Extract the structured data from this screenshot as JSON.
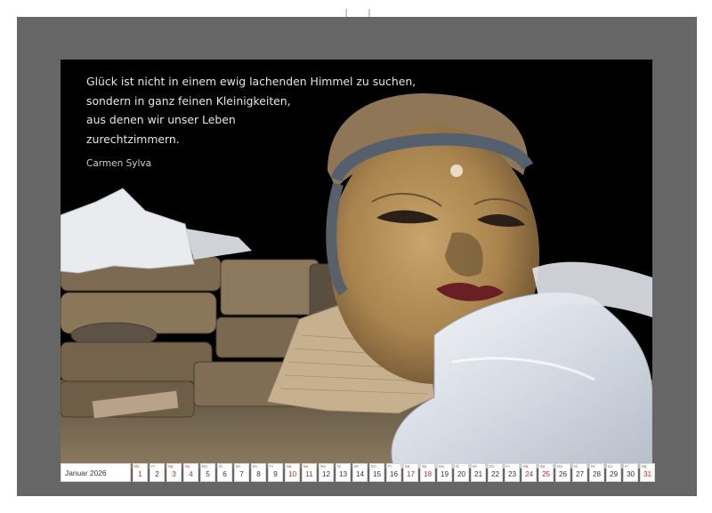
{
  "quote": {
    "lines": [
      "Glück ist nicht in einem ewig lachenden Himmel zu suchen,",
      "sondern in ganz feinen Kleinigkeiten,",
      "aus denen wir unser Leben",
      "zurechtzimmern."
    ],
    "author": "Carmen Sylva"
  },
  "calendar": {
    "month_label": "Januar 2026",
    "days": [
      {
        "wd": "Do",
        "num": "1",
        "holiday": true
      },
      {
        "wd": "Fr",
        "num": "2",
        "holiday": false
      },
      {
        "wd": "Sa",
        "num": "3",
        "holiday": true
      },
      {
        "wd": "So",
        "num": "4",
        "holiday": true
      },
      {
        "wd": "Mo",
        "num": "5",
        "holiday": false
      },
      {
        "wd": "Di",
        "num": "6",
        "holiday": false
      },
      {
        "wd": "Mi",
        "num": "7",
        "holiday": false
      },
      {
        "wd": "Do",
        "num": "8",
        "holiday": false
      },
      {
        "wd": "Fr",
        "num": "9",
        "holiday": false
      },
      {
        "wd": "Sa",
        "num": "10",
        "holiday": true
      },
      {
        "wd": "So",
        "num": "11",
        "holiday": true
      },
      {
        "wd": "Mo",
        "num": "12",
        "holiday": false
      },
      {
        "wd": "Di",
        "num": "13",
        "holiday": false
      },
      {
        "wd": "Mi",
        "num": "14",
        "holiday": false
      },
      {
        "wd": "Do",
        "num": "15",
        "holiday": false
      },
      {
        "wd": "Fr",
        "num": "16",
        "holiday": false
      },
      {
        "wd": "Sa",
        "num": "17",
        "holiday": true
      },
      {
        "wd": "So",
        "num": "18",
        "holiday": true
      },
      {
        "wd": "Mo",
        "num": "19",
        "holiday": false
      },
      {
        "wd": "Di",
        "num": "20",
        "holiday": false
      },
      {
        "wd": "Mi",
        "num": "21",
        "holiday": false
      },
      {
        "wd": "Do",
        "num": "22",
        "holiday": false
      },
      {
        "wd": "Fr",
        "num": "23",
        "holiday": false
      },
      {
        "wd": "Sa",
        "num": "24",
        "holiday": true
      },
      {
        "wd": "So",
        "num": "25",
        "holiday": true
      },
      {
        "wd": "Mo",
        "num": "26",
        "holiday": false
      },
      {
        "wd": "Di",
        "num": "27",
        "holiday": false
      },
      {
        "wd": "Mi",
        "num": "28",
        "holiday": false
      },
      {
        "wd": "Do",
        "num": "29",
        "holiday": false
      },
      {
        "wd": "Fr",
        "num": "30",
        "holiday": false
      },
      {
        "wd": "Sa",
        "num": "31",
        "holiday": true
      }
    ]
  },
  "colors": {
    "sheet": "#666666",
    "photo_background": "#000000",
    "weekend_red": "#b23030"
  }
}
